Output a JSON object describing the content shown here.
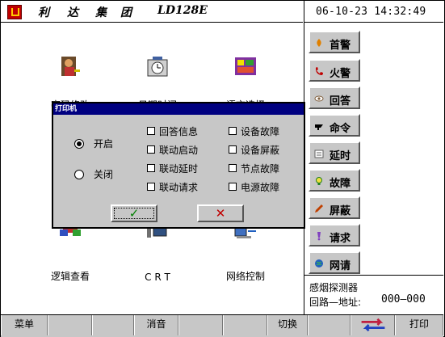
{
  "titlebar": {
    "title_words": [
      "利",
      "达",
      "集",
      "团"
    ],
    "model": "LD128E",
    "datetime": "06-10-23 14:32:49"
  },
  "main_icons": [
    {
      "label": "密码修改",
      "icon": "key-person-icon"
    },
    {
      "label": "日期时间",
      "icon": "clock-icon"
    },
    {
      "label": "语言选择",
      "icon": "language-icon"
    },
    {
      "label": "逻辑查看",
      "icon": "logic-icon"
    },
    {
      "label": "C R T",
      "icon": "crt-monitor-icon"
    },
    {
      "label": "网络控制",
      "icon": "network-icon"
    }
  ],
  "right_buttons": [
    {
      "label": "首警",
      "icon": "flame-icon",
      "color": "#e08000"
    },
    {
      "label": "火警",
      "icon": "phone-icon",
      "color": "#c00000"
    },
    {
      "label": "回答",
      "icon": "eye-icon",
      "color": "#806040"
    },
    {
      "label": "命令",
      "icon": "command-icon",
      "color": "#000000"
    },
    {
      "label": "延时",
      "icon": "delay-icon",
      "color": "#606060"
    },
    {
      "label": "故障",
      "icon": "bulb-icon",
      "color": "#208020"
    },
    {
      "label": "屏蔽",
      "icon": "pencil-icon",
      "color": "#c04000"
    },
    {
      "label": "请求",
      "icon": "request-icon",
      "color": "#8040c0"
    },
    {
      "label": "网请",
      "icon": "globe-icon",
      "color": "#2060c0"
    }
  ],
  "info": {
    "device": "感烟探测器",
    "address_label": "回路—地址:",
    "address_value": "000—000"
  },
  "bottom_bar": {
    "menu": "菜单",
    "mute": "消音",
    "switch": "切换",
    "print": "打印"
  },
  "dialog": {
    "title": "打印机",
    "radio_on": "开启",
    "radio_off": "关闭",
    "selected": "开启",
    "checkboxes_left": [
      "回答信息",
      "联动启动",
      "联动延时",
      "联动请求"
    ],
    "checkboxes_right": [
      "设备故障",
      "设备屏蔽",
      "节点故障",
      "电源故障"
    ],
    "ok_symbol": "✓",
    "cancel_symbol": "✕",
    "ok_color": "#008000",
    "cancel_color": "#c00000"
  }
}
